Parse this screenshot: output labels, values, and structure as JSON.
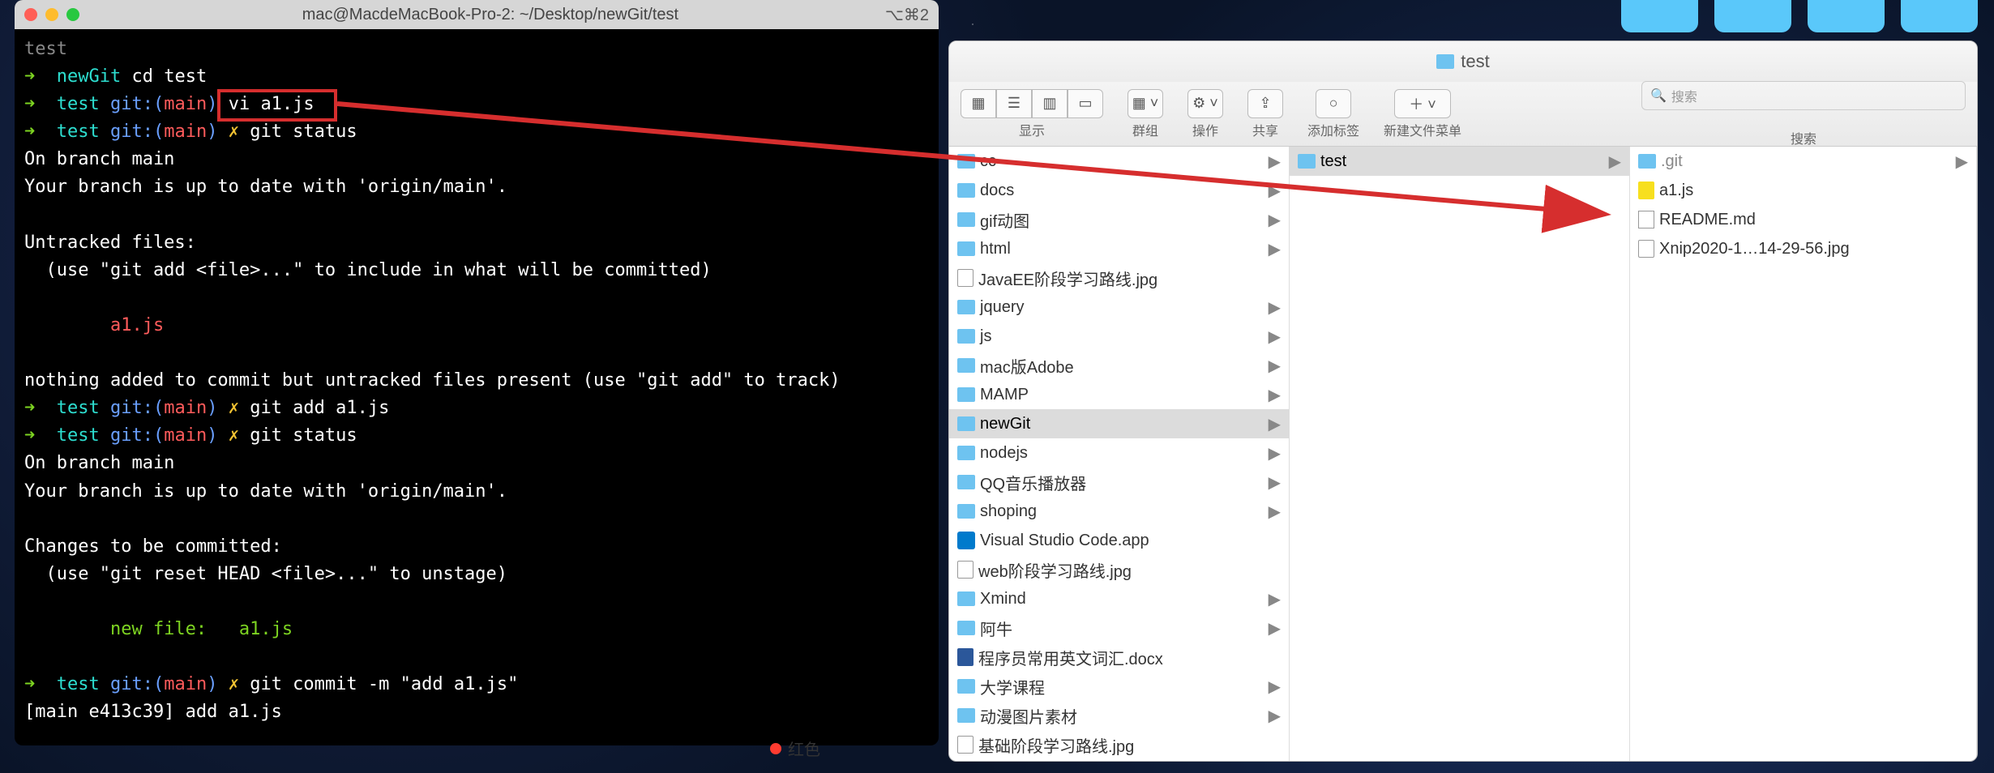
{
  "terminal": {
    "title": "mac@MacdeMacBook-Pro-2: ~/Desktop/newGit/test",
    "shortcut": "⌥⌘2",
    "lines": {
      "l0": "test",
      "newGitLabel": "newGit",
      "cdTest": " cd test",
      "testLabel": "test",
      "gitMain": "git:(",
      "main": "main",
      "gitMainClose": ")",
      "cross": "✗",
      "viCmd": "vi a1.js",
      "gitStatus": "git status",
      "onBranch": "On branch main",
      "upToDate": "Your branch is up to date with 'origin/main'.",
      "untracked": "Untracked files:",
      "useAdd": "  (use \"git add <file>...\" to include in what will be committed)",
      "a1": "        a1.js",
      "nothingAdded": "nothing added to commit but untracked files present (use \"git add\" to track)",
      "gitAdd": "git add a1.js",
      "changes": "Changes to be committed:",
      "useReset": "  (use \"git reset HEAD <file>...\" to unstage)",
      "newFile": "        new file:   a1.js",
      "commitCmd": "git commit -m \"add a1.js\"",
      "commitResult": "[main e413c39] add a1.js"
    }
  },
  "finder": {
    "title": "test",
    "toolbar": {
      "view": "显示",
      "group": "群组",
      "action": "操作",
      "share": "共享",
      "tags": "添加标签",
      "newFolder": "新建文件菜单",
      "searchLabel": "搜索",
      "searchPlaceholder": "搜索"
    },
    "col1": [
      {
        "name": "cc",
        "type": "folder",
        "arrow": true
      },
      {
        "name": "docs",
        "type": "folder",
        "arrow": true
      },
      {
        "name": "gif动图",
        "type": "folder",
        "arrow": true
      },
      {
        "name": "html",
        "type": "folder",
        "arrow": true
      },
      {
        "name": "JavaEE阶段学习路线.jpg",
        "type": "file"
      },
      {
        "name": "jquery",
        "type": "folder",
        "arrow": true
      },
      {
        "name": "js",
        "type": "folder",
        "arrow": true
      },
      {
        "name": "mac版Adobe",
        "type": "folder",
        "arrow": true
      },
      {
        "name": "MAMP",
        "type": "folder",
        "arrow": true
      },
      {
        "name": "newGit",
        "type": "folder",
        "arrow": true,
        "selected": true
      },
      {
        "name": "nodejs",
        "type": "folder",
        "arrow": true
      },
      {
        "name": "QQ音乐播放器",
        "type": "folder",
        "arrow": true
      },
      {
        "name": "shoping",
        "type": "folder",
        "arrow": true
      },
      {
        "name": "Visual Studio Code.app",
        "type": "vscode"
      },
      {
        "name": "web阶段学习路线.jpg",
        "type": "file"
      },
      {
        "name": "Xmind",
        "type": "folder",
        "arrow": true
      },
      {
        "name": "阿牛",
        "type": "folder",
        "arrow": true
      },
      {
        "name": "程序员常用英文词汇.docx",
        "type": "word"
      },
      {
        "name": "大学课程",
        "type": "folder",
        "arrow": true
      },
      {
        "name": "动漫图片素材",
        "type": "folder",
        "arrow": true
      },
      {
        "name": "基础阶段学习路线.jpg",
        "type": "file"
      }
    ],
    "col2": [
      {
        "name": "test",
        "type": "folder",
        "arrow": true,
        "selected": true
      }
    ],
    "col3": [
      {
        "name": ".git",
        "type": "folder",
        "arrow": true,
        "dim": true
      },
      {
        "name": "a1.js",
        "type": "js"
      },
      {
        "name": "README.md",
        "type": "md"
      },
      {
        "name": "Xnip2020-1…14-29-56.jpg",
        "type": "file"
      }
    ]
  },
  "tag": {
    "redLabel": "红色"
  }
}
